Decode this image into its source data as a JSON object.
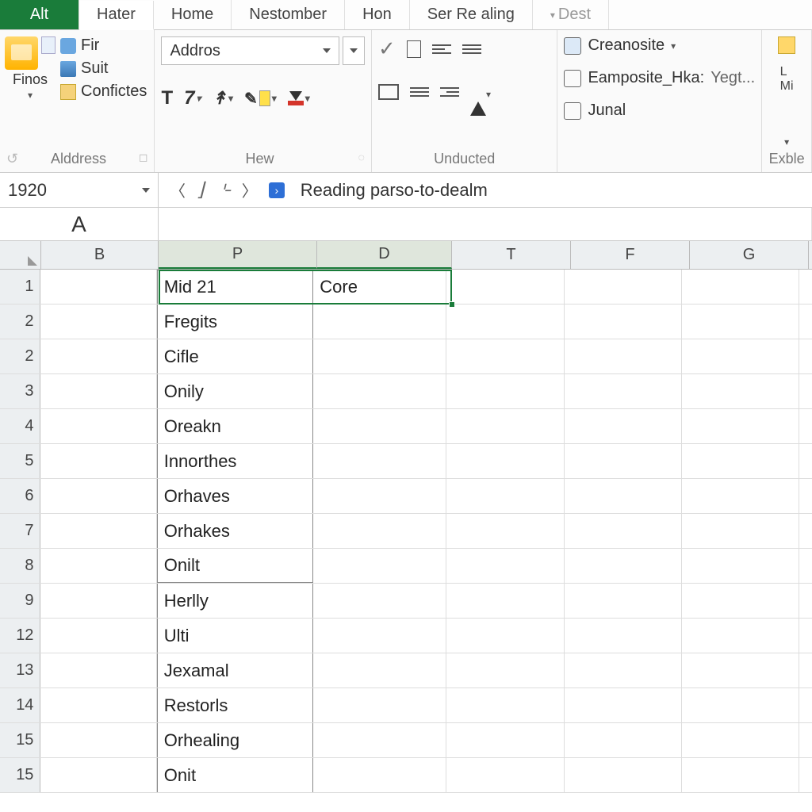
{
  "tabs": {
    "file": "Alt",
    "items": [
      "Hater",
      "Home",
      "Nestomber",
      "Hon",
      "Ser Re aling",
      "Dest"
    ]
  },
  "ribbon": {
    "group1": {
      "bigLabel": "Finos",
      "items": [
        "Fir",
        "Suit",
        "Confictes"
      ],
      "groupLabel": "Alddress"
    },
    "group2": {
      "font": "Addros",
      "boldT": "T",
      "ital7": "7",
      "groupLabel": "Hew"
    },
    "group3": {
      "groupLabel": "Unducted"
    },
    "group4": {
      "items": [
        "Creanosite",
        "Eamposite_Hka:",
        "Junal"
      ],
      "extra": "Yegt..."
    },
    "group5": {
      "label": "Exble",
      "l1": "L",
      "l2": "Mi"
    }
  },
  "nameBox": "1920",
  "formulaText": "Reading parso-to-dealm",
  "bigA": "A",
  "columns": [
    "B",
    "P",
    "D",
    "T",
    "F",
    "G"
  ],
  "rows": [
    {
      "n": "1",
      "p": "Mid 21",
      "d": "Core"
    },
    {
      "n": "2",
      "p": "Fregits",
      "d": ""
    },
    {
      "n": "2",
      "p": "Cifle",
      "d": ""
    },
    {
      "n": "3",
      "p": "Onily",
      "d": ""
    },
    {
      "n": "4",
      "p": "Oreakn",
      "d": ""
    },
    {
      "n": "5",
      "p": "Innorthes",
      "d": ""
    },
    {
      "n": "6",
      "p": "Orhaves",
      "d": ""
    },
    {
      "n": "7",
      "p": "Orhakes",
      "d": ""
    },
    {
      "n": "8",
      "p": "Onilt",
      "d": ""
    },
    {
      "n": "9",
      "p": "Herlly",
      "d": ""
    },
    {
      "n": "12",
      "p": "Ulti",
      "d": ""
    },
    {
      "n": "13",
      "p": "Jexamal",
      "d": ""
    },
    {
      "n": "14",
      "p": "Restorls",
      "d": ""
    },
    {
      "n": "15",
      "p": "Orhealing",
      "d": ""
    },
    {
      "n": "15",
      "p": "Onit",
      "d": ""
    }
  ]
}
